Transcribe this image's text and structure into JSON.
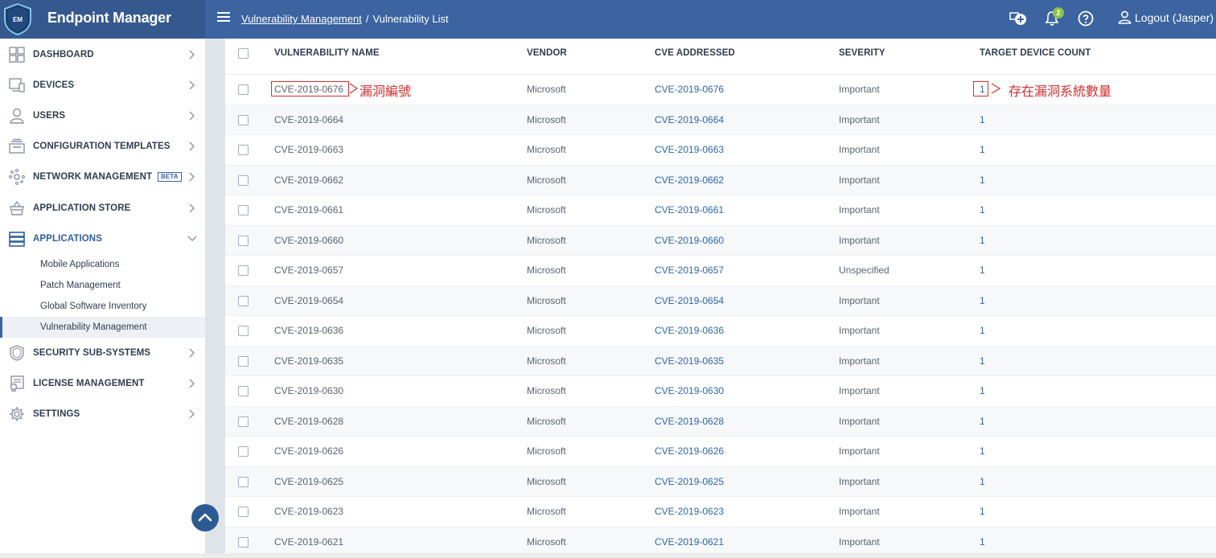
{
  "app": {
    "title": "Endpoint Manager",
    "logo_text": "EM"
  },
  "header": {
    "breadcrumb_link": "Vulnerability Management",
    "breadcrumb_sep": "/",
    "breadcrumb_current": "Vulnerability List",
    "notification_count": "2",
    "logout_label": "Logout (Jasper)"
  },
  "sidebar": {
    "items": [
      {
        "label": "DASHBOARD",
        "icon": "dashboard-icon"
      },
      {
        "label": "DEVICES",
        "icon": "devices-icon"
      },
      {
        "label": "USERS",
        "icon": "user-icon"
      },
      {
        "label": "CONFIGURATION TEMPLATES",
        "icon": "templates-icon"
      },
      {
        "label": "NETWORK MANAGEMENT",
        "icon": "network-icon",
        "badge": "BETA"
      },
      {
        "label": "APPLICATION STORE",
        "icon": "basket-icon"
      },
      {
        "label": "APPLICATIONS",
        "icon": "applications-icon"
      },
      {
        "label": "SECURITY SUB-SYSTEMS",
        "icon": "shield-icon"
      },
      {
        "label": "LICENSE MANAGEMENT",
        "icon": "license-icon"
      },
      {
        "label": "SETTINGS",
        "icon": "gear-icon"
      }
    ],
    "sub_items": [
      {
        "label": "Mobile Applications"
      },
      {
        "label": "Patch Management"
      },
      {
        "label": "Global Software Inventory"
      },
      {
        "label": "Vulnerability Management"
      }
    ]
  },
  "table": {
    "columns": [
      "VULNERABILITY NAME",
      "VENDOR",
      "CVE ADDRESSED",
      "SEVERITY",
      "TARGET DEVICE COUNT"
    ],
    "rows": [
      {
        "name": "CVE-2019-0676",
        "vendor": "Microsoft",
        "cve": "CVE-2019-0676",
        "severity": "Important",
        "count": "1"
      },
      {
        "name": "CVE-2019-0664",
        "vendor": "Microsoft",
        "cve": "CVE-2019-0664",
        "severity": "Important",
        "count": "1"
      },
      {
        "name": "CVE-2019-0663",
        "vendor": "Microsoft",
        "cve": "CVE-2019-0663",
        "severity": "Important",
        "count": "1"
      },
      {
        "name": "CVE-2019-0662",
        "vendor": "Microsoft",
        "cve": "CVE-2019-0662",
        "severity": "Important",
        "count": "1"
      },
      {
        "name": "CVE-2019-0661",
        "vendor": "Microsoft",
        "cve": "CVE-2019-0661",
        "severity": "Important",
        "count": "1"
      },
      {
        "name": "CVE-2019-0660",
        "vendor": "Microsoft",
        "cve": "CVE-2019-0660",
        "severity": "Important",
        "count": "1"
      },
      {
        "name": "CVE-2019-0657",
        "vendor": "Microsoft",
        "cve": "CVE-2019-0657",
        "severity": "Unspecified",
        "count": "1"
      },
      {
        "name": "CVE-2019-0654",
        "vendor": "Microsoft",
        "cve": "CVE-2019-0654",
        "severity": "Important",
        "count": "1"
      },
      {
        "name": "CVE-2019-0636",
        "vendor": "Microsoft",
        "cve": "CVE-2019-0636",
        "severity": "Important",
        "count": "1"
      },
      {
        "name": "CVE-2019-0635",
        "vendor": "Microsoft",
        "cve": "CVE-2019-0635",
        "severity": "Important",
        "count": "1"
      },
      {
        "name": "CVE-2019-0630",
        "vendor": "Microsoft",
        "cve": "CVE-2019-0630",
        "severity": "Important",
        "count": "1"
      },
      {
        "name": "CVE-2019-0628",
        "vendor": "Microsoft",
        "cve": "CVE-2019-0628",
        "severity": "Important",
        "count": "1"
      },
      {
        "name": "CVE-2019-0626",
        "vendor": "Microsoft",
        "cve": "CVE-2019-0626",
        "severity": "Important",
        "count": "1"
      },
      {
        "name": "CVE-2019-0625",
        "vendor": "Microsoft",
        "cve": "CVE-2019-0625",
        "severity": "Important",
        "count": "1"
      },
      {
        "name": "CVE-2019-0623",
        "vendor": "Microsoft",
        "cve": "CVE-2019-0623",
        "severity": "Important",
        "count": "1"
      },
      {
        "name": "CVE-2019-0621",
        "vendor": "Microsoft",
        "cve": "CVE-2019-0621",
        "severity": "Important",
        "count": "1"
      }
    ]
  },
  "annotations": {
    "name_note": "漏洞編號",
    "count_note": "存在漏洞系統數量"
  },
  "colors": {
    "header": "#3b64a0",
    "link": "#2e67a8",
    "annotation": "#d32f2f",
    "badge": "#8bc34a"
  }
}
